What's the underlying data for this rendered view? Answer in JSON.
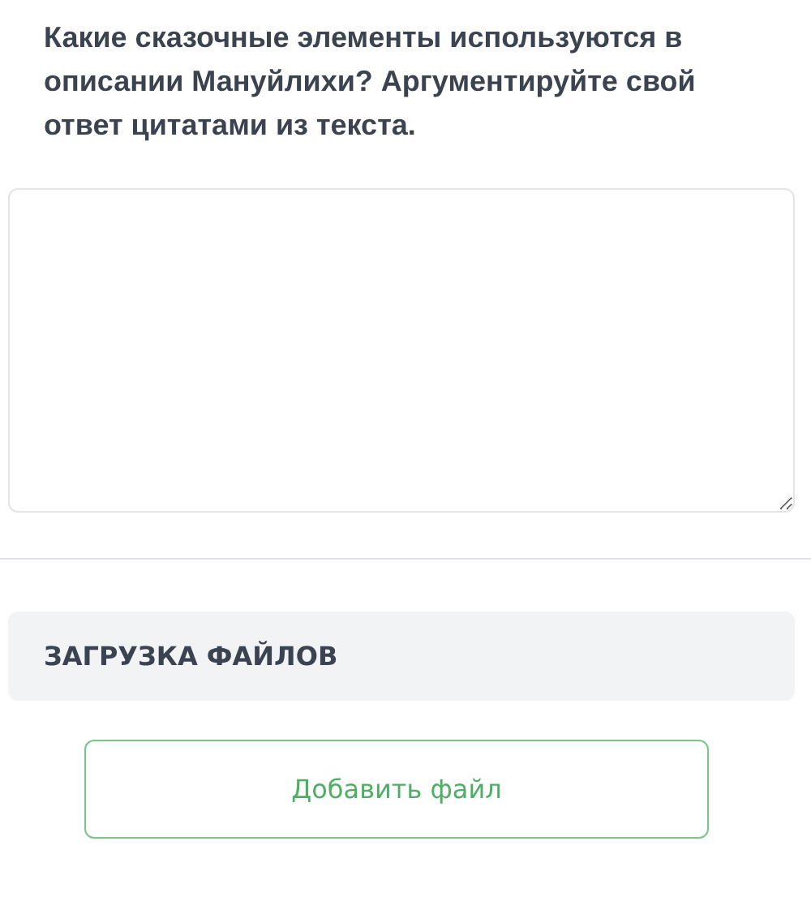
{
  "question": "Какие сказочные элементы используются в описании Мануйлихи? Аргументируйте свой ответ цитатами из текста.",
  "upload": {
    "title": "ЗАГРУЗКА ФАЙЛОВ",
    "button": "Добавить файл"
  }
}
